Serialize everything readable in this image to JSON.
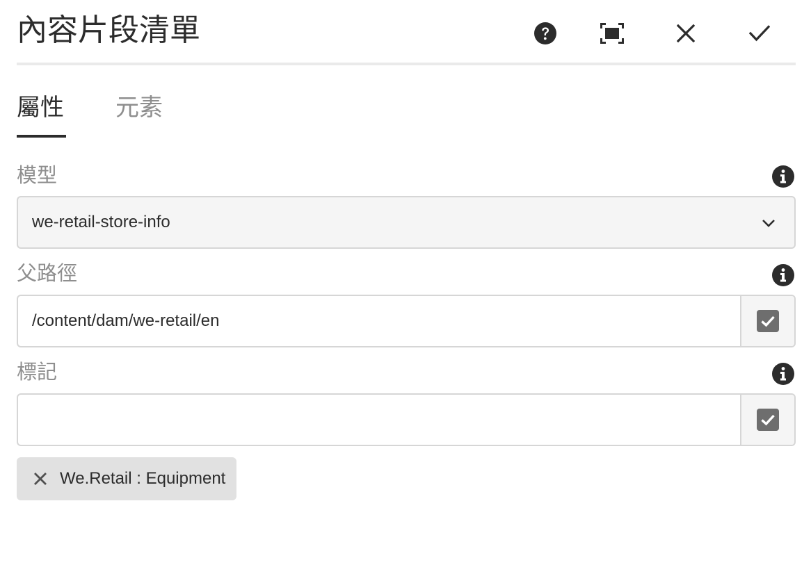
{
  "dialog": {
    "title": "內容片段清單",
    "actions": {
      "help_icon": "help-circle-icon",
      "fullscreen_icon": "fullscreen-icon",
      "cancel_icon": "close-icon",
      "done_icon": "checkmark-icon"
    }
  },
  "tabs": [
    {
      "label": "屬性",
      "active": true
    },
    {
      "label": "元素",
      "active": false
    }
  ],
  "fields": {
    "model": {
      "label": "模型",
      "value": "we-retail-store-info"
    },
    "parent_path": {
      "label": "父路徑",
      "value": "/content/dam/we-retail/en"
    },
    "tags": {
      "label": "標記",
      "value": "",
      "selected_tags": [
        {
          "label": "We.Retail : Equipment"
        }
      ]
    }
  },
  "colors": {
    "text_primary": "#2c2c2c",
    "text_secondary": "#8e8e8e",
    "border": "#d6d6d6",
    "field_bg": "#f5f5f5",
    "chip_bg": "#e1e1e1",
    "icon_dark": "#2c2c2c",
    "checkbox_bg": "#6e6e6e"
  }
}
